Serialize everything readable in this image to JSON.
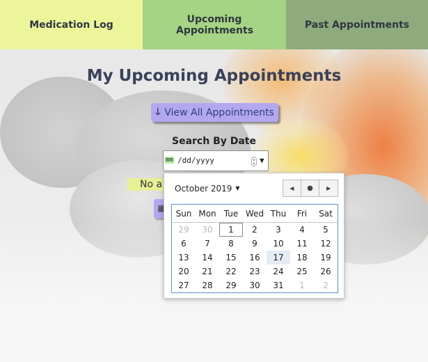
{
  "nav": {
    "tabs": [
      {
        "label": "Medication Log"
      },
      {
        "label": "Upcoming Appointments"
      },
      {
        "label": "Past Appointments"
      }
    ]
  },
  "main": {
    "title": "My Upcoming Appointments",
    "view_all_label": "View All Appointments",
    "view_all_icon": "arrow-down-icon",
    "search_label": "Search By Date",
    "date_input": {
      "month_placeholder": "mm",
      "rest_placeholder": "/dd/yyyy"
    },
    "no_appointments_text": "No a",
    "add_icon": "calendar-plus-icon"
  },
  "calendar": {
    "month_label": "October 2019",
    "weekdays": [
      "Sun",
      "Mon",
      "Tue",
      "Wed",
      "Thu",
      "Fri",
      "Sat"
    ],
    "weeks": [
      [
        "29",
        "30",
        "1",
        "2",
        "3",
        "4",
        "5"
      ],
      [
        "6",
        "7",
        "8",
        "9",
        "10",
        "11",
        "12"
      ],
      [
        "13",
        "14",
        "15",
        "16",
        "17",
        "18",
        "19"
      ],
      [
        "20",
        "21",
        "22",
        "23",
        "24",
        "25",
        "26"
      ],
      [
        "27",
        "28",
        "29",
        "30",
        "31",
        "1",
        "2"
      ]
    ],
    "selected_day": "1",
    "today": "17",
    "colors": {
      "today_bg": "#e4ecf7",
      "grid_border": "#5b8fd6"
    }
  },
  "colors": {
    "tab1": "#ecf59a",
    "tab2": "#a5d484",
    "tab3": "#8fab7d",
    "button": "#b3a8ef"
  }
}
